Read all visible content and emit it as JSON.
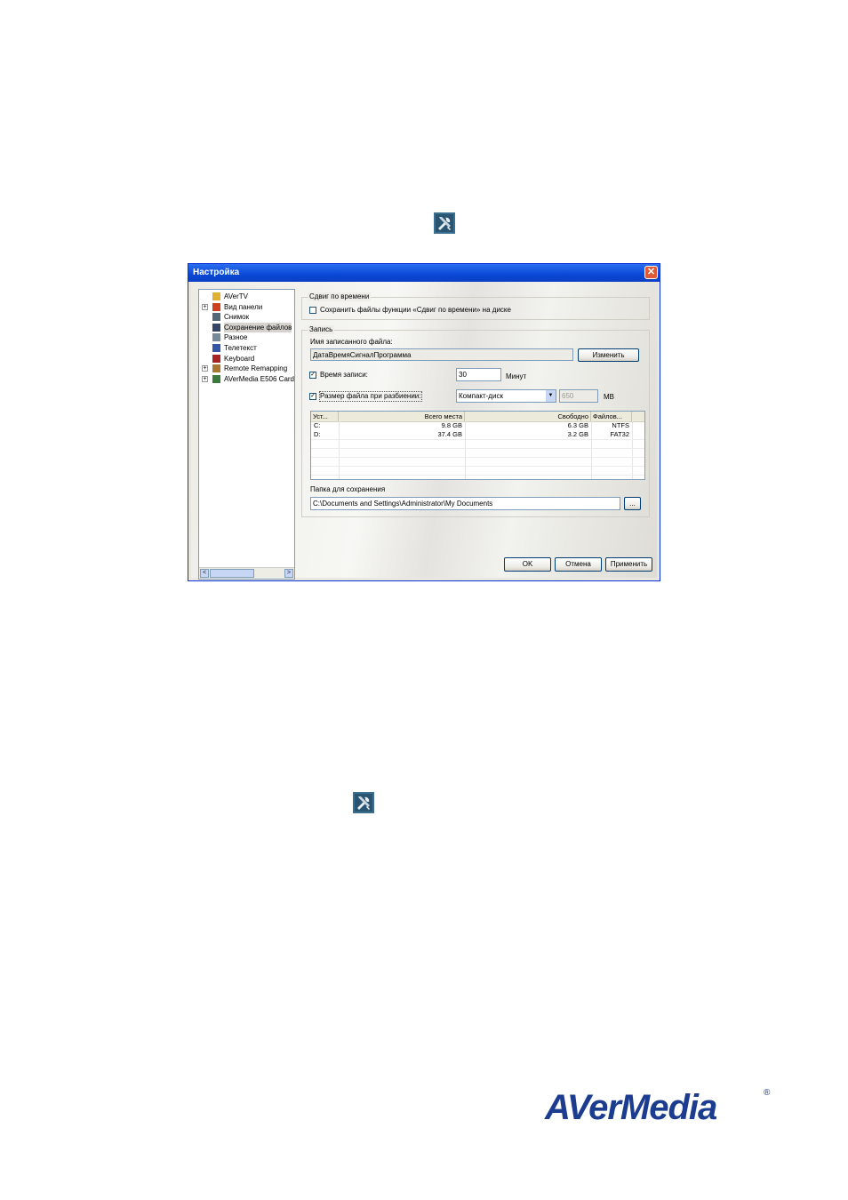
{
  "dialog": {
    "title": "Настройка",
    "close_glyph": "✕"
  },
  "tree": {
    "items": [
      {
        "label": "AVerTV",
        "icon": "app-icon",
        "expander": ""
      },
      {
        "label": "Вид панели",
        "icon": "panel-view-icon",
        "expander": "+"
      },
      {
        "label": "Снимок",
        "icon": "snapshot-icon",
        "expander": ""
      },
      {
        "label": "Сохранение файлов",
        "icon": "save-files-icon",
        "expander": ""
      },
      {
        "label": "Разное",
        "icon": "misc-icon",
        "expander": ""
      },
      {
        "label": "Телетекст",
        "icon": "teletext-icon",
        "expander": ""
      },
      {
        "label": "Keyboard",
        "icon": "keyboard-icon",
        "expander": ""
      },
      {
        "label": "Remote Remapping",
        "icon": "remote-icon",
        "expander": "+"
      },
      {
        "label": "AVerMedia E506 Card",
        "icon": "card-icon",
        "expander": "+"
      }
    ],
    "selected_index": 3,
    "scroll_left": "<",
    "scroll_right": ">"
  },
  "timeshift": {
    "title": "Сдвиг по времени",
    "save_checkbox_label": "Сохранить файлы функции «Сдвиг по времени» на диске",
    "save_checked": false
  },
  "record": {
    "title": "Запись",
    "filename_label": "Имя записанного файла:",
    "filename_value": "ДатаВремяСигналПрограмма",
    "change_button": "Изменить",
    "time_label": "Время записи:",
    "time_checked": true,
    "time_value": "30",
    "time_unit": "Минут",
    "split_label": "Размер файла при разбиении:",
    "split_checked": true,
    "split_select": "Компакт-диск",
    "split_size": "650",
    "split_unit": "MB",
    "check_glyph": "✓",
    "dropdown_glyph": "▼",
    "drives": {
      "columns": [
        "Уст...",
        "Всего места",
        "Свободно",
        "Файлов..."
      ],
      "rows": [
        [
          "C:",
          "9.8 GB",
          "6.3 GB",
          "NTFS"
        ],
        [
          "D:",
          "37.4 GB",
          "3.2 GB",
          "FAT32"
        ]
      ]
    },
    "folder_label": "Папка для сохранения",
    "folder_value": "C:\\Documents and Settings\\Administrator\\My Documents",
    "browse_button": "..."
  },
  "buttons": {
    "ok": "OK",
    "cancel": "Отмена",
    "apply": "Применить"
  },
  "brand": {
    "logo_text": "AVerMedia",
    "registered": "®",
    "color": "#1c3c8f"
  }
}
